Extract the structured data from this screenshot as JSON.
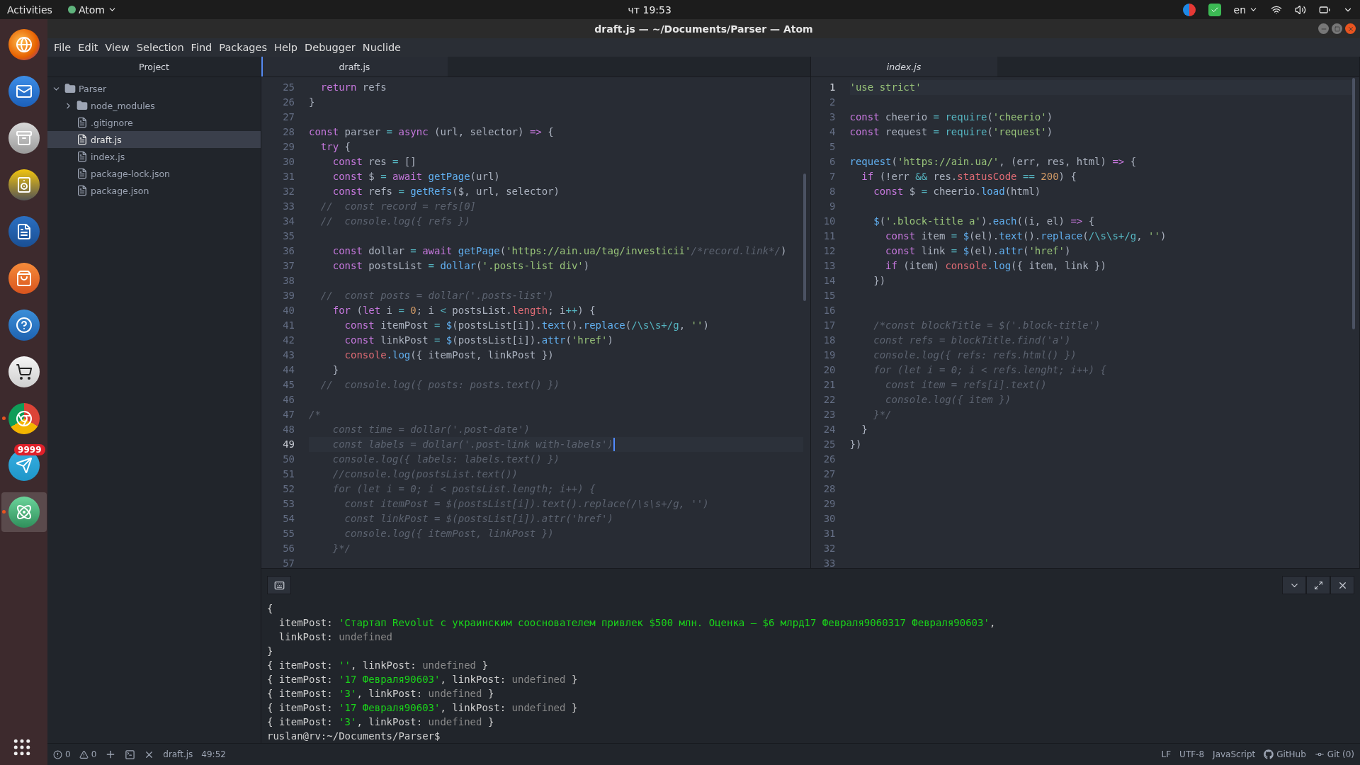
{
  "top_bar": {
    "activities": "Activities",
    "app_menu": "Atom",
    "clock": "чт 19:53",
    "language": "en"
  },
  "dock": [
    {
      "kind": "browser",
      "running": false,
      "selected": false
    },
    {
      "kind": "mail",
      "running": false,
      "selected": false
    },
    {
      "kind": "files",
      "running": false,
      "selected": false
    },
    {
      "kind": "speaker",
      "running": false,
      "selected": false
    },
    {
      "kind": "writer",
      "running": false,
      "selected": false
    },
    {
      "kind": "store",
      "running": false,
      "selected": false
    },
    {
      "kind": "help",
      "running": false,
      "selected": false
    },
    {
      "kind": "cart",
      "running": false,
      "selected": false
    },
    {
      "kind": "chrome",
      "running": true,
      "selected": false
    },
    {
      "kind": "plane",
      "running": false,
      "selected": false,
      "badge": "9999"
    },
    {
      "kind": "atom",
      "running": true,
      "selected": true
    }
  ],
  "window": {
    "title": "draft.js — ~/Documents/Parser — Atom"
  },
  "menu": [
    "File",
    "Edit",
    "View",
    "Selection",
    "Find",
    "Packages",
    "Help",
    "Debugger",
    "Nuclide"
  ],
  "tree": {
    "tab": "Project",
    "root": {
      "name": "Parser",
      "kind": "folder",
      "expanded": true,
      "selected": false,
      "children": [
        {
          "name": "node_modules",
          "kind": "folder",
          "expanded": false,
          "selected": false
        },
        {
          "name": ".gitignore",
          "kind": "file",
          "selected": false
        },
        {
          "name": "draft.js",
          "kind": "file",
          "selected": true
        },
        {
          "name": "index.js",
          "kind": "file",
          "selected": false
        },
        {
          "name": "package-lock.json",
          "kind": "file",
          "selected": false
        },
        {
          "name": "package.json",
          "kind": "file",
          "selected": false
        }
      ]
    }
  },
  "panes": [
    {
      "focused": true,
      "tabs": [
        {
          "label": "draft.js",
          "selected": true,
          "pending": false
        }
      ],
      "lines": [
        {
          "n": "25",
          "current": false,
          "tokens": [
            {
              "kind": "kw",
              "text": "  return"
            },
            {
              "kind": "p",
              "text": " refs"
            }
          ]
        },
        {
          "n": "26",
          "current": false,
          "tokens": [
            {
              "kind": "p",
              "text": "}"
            }
          ]
        },
        {
          "n": "27",
          "current": false
        },
        {
          "n": "28",
          "current": false,
          "tokens": [
            {
              "kind": "kw",
              "text": "const"
            },
            {
              "kind": "p",
              "text": " parser"
            },
            {
              "kind": "op",
              "text": " ="
            },
            {
              "kind": "kw",
              "text": " async"
            },
            {
              "kind": "p",
              "text": " (url, selector)"
            },
            {
              "kind": "kw",
              "text": " =>"
            },
            {
              "kind": "p",
              "text": " {"
            }
          ]
        },
        {
          "n": "29",
          "current": false,
          "tokens": [
            {
              "kind": "kw",
              "text": "  try"
            },
            {
              "kind": "p",
              "text": " {"
            }
          ]
        },
        {
          "n": "30",
          "current": false,
          "tokens": [
            {
              "kind": "kw",
              "text": "    const"
            },
            {
              "kind": "p",
              "text": " res"
            },
            {
              "kind": "op",
              "text": " ="
            },
            {
              "kind": "p",
              "text": " []"
            }
          ]
        },
        {
          "n": "31",
          "current": false,
          "tokens": [
            {
              "kind": "kw",
              "text": "    const"
            },
            {
              "kind": "p",
              "text": " $"
            },
            {
              "kind": "op",
              "text": " ="
            },
            {
              "kind": "kw",
              "text": " await"
            },
            {
              "kind": "fn",
              "text": " getPage"
            },
            {
              "kind": "p",
              "text": "(url)"
            }
          ]
        },
        {
          "n": "32",
          "current": false,
          "tokens": [
            {
              "kind": "kw",
              "text": "    const"
            },
            {
              "kind": "p",
              "text": " refs"
            },
            {
              "kind": "op",
              "text": " ="
            },
            {
              "kind": "fn",
              "text": " getRefs"
            },
            {
              "kind": "p",
              "text": "($, url, selector)"
            }
          ]
        },
        {
          "n": "33",
          "current": false,
          "tokens": [
            {
              "kind": "cm",
              "text": "  //  const record = refs[0]"
            }
          ]
        },
        {
          "n": "34",
          "current": false,
          "tokens": [
            {
              "kind": "cm",
              "text": "  //  console.log({ refs })"
            }
          ]
        },
        {
          "n": "35",
          "current": false
        },
        {
          "n": "36",
          "current": false,
          "tokens": [
            {
              "kind": "kw",
              "text": "    const"
            },
            {
              "kind": "p",
              "text": " dollar"
            },
            {
              "kind": "op",
              "text": " ="
            },
            {
              "kind": "kw",
              "text": " await"
            },
            {
              "kind": "fn",
              "text": " getPage"
            },
            {
              "kind": "p",
              "text": "("
            },
            {
              "kind": "str",
              "text": "'https://ain.ua/tag/investicii'"
            },
            {
              "kind": "cm",
              "text": "/*record.link*/"
            },
            {
              "kind": "p",
              "text": ")"
            }
          ]
        },
        {
          "n": "37",
          "current": false,
          "tokens": [
            {
              "kind": "kw",
              "text": "    const"
            },
            {
              "kind": "p",
              "text": " postsList"
            },
            {
              "kind": "op",
              "text": " ="
            },
            {
              "kind": "fn",
              "text": " dollar"
            },
            {
              "kind": "p",
              "text": "("
            },
            {
              "kind": "str",
              "text": "'.posts-list div'"
            },
            {
              "kind": "p",
              "text": ")"
            }
          ]
        },
        {
          "n": "38",
          "current": false
        },
        {
          "n": "39",
          "current": false,
          "tokens": [
            {
              "kind": "cm",
              "text": "  //  const posts = dollar('.posts-list')"
            }
          ]
        },
        {
          "n": "40",
          "current": false,
          "tokens": [
            {
              "kind": "kw",
              "text": "    for"
            },
            {
              "kind": "p",
              "text": " ("
            },
            {
              "kind": "kw",
              "text": "let"
            },
            {
              "kind": "p",
              "text": " i"
            },
            {
              "kind": "op",
              "text": " ="
            },
            {
              "kind": "num",
              "text": " 0"
            },
            {
              "kind": "p",
              "text": "; i"
            },
            {
              "kind": "op",
              "text": " <"
            },
            {
              "kind": "p",
              "text": " postsList."
            },
            {
              "kind": "prop",
              "text": "length"
            },
            {
              "kind": "p",
              "text": "; i"
            },
            {
              "kind": "op",
              "text": "++"
            },
            {
              "kind": "p",
              "text": ") {"
            }
          ]
        },
        {
          "n": "41",
          "current": false,
          "tokens": [
            {
              "kind": "kw",
              "text": "      const"
            },
            {
              "kind": "p",
              "text": " itemPost"
            },
            {
              "kind": "op",
              "text": " ="
            },
            {
              "kind": "fn",
              "text": " $"
            },
            {
              "kind": "p",
              "text": "(postsList[i])."
            },
            {
              "kind": "fn",
              "text": "text"
            },
            {
              "kind": "p",
              "text": "()."
            },
            {
              "kind": "fn",
              "text": "replace"
            },
            {
              "kind": "p",
              "text": "("
            },
            {
              "kind": "op",
              "text": "/\\s\\s+/g"
            },
            {
              "kind": "p",
              "text": ","
            },
            {
              "kind": "str",
              "text": " ''"
            },
            {
              "kind": "p",
              "text": ")"
            }
          ]
        },
        {
          "n": "42",
          "current": false,
          "tokens": [
            {
              "kind": "kw",
              "text": "      const"
            },
            {
              "kind": "p",
              "text": " linkPost"
            },
            {
              "kind": "op",
              "text": " ="
            },
            {
              "kind": "fn",
              "text": " $"
            },
            {
              "kind": "p",
              "text": "(postsList[i])."
            },
            {
              "kind": "fn",
              "text": "attr"
            },
            {
              "kind": "p",
              "text": "("
            },
            {
              "kind": "str",
              "text": "'href'"
            },
            {
              "kind": "p",
              "text": ")"
            }
          ]
        },
        {
          "n": "43",
          "current": false,
          "tokens": [
            {
              "kind": "prop",
              "text": "      console"
            },
            {
              "kind": "fn",
              "text": ".log"
            },
            {
              "kind": "p",
              "text": "({ itemPost, linkPost })"
            }
          ]
        },
        {
          "n": "44",
          "current": false,
          "tokens": [
            {
              "kind": "p",
              "text": "    }"
            }
          ]
        },
        {
          "n": "45",
          "current": false,
          "tokens": [
            {
              "kind": "cm",
              "text": "  //  console.log({ posts: posts.text() })"
            }
          ]
        },
        {
          "n": "46",
          "current": false
        },
        {
          "n": "47",
          "current": false,
          "tokens": [
            {
              "kind": "cm",
              "text": "/*"
            }
          ]
        },
        {
          "n": "48",
          "current": false,
          "tokens": [
            {
              "kind": "cm",
              "text": "    const time = dollar('.post-date')"
            }
          ]
        },
        {
          "n": "49",
          "current": true,
          "tokens": [
            {
              "kind": "cm",
              "text": "    const labels = dollar('.post-link with-labels')"
            }
          ]
        },
        {
          "n": "50",
          "current": false,
          "tokens": [
            {
              "kind": "cm",
              "text": "    console.log({ labels: labels.text() })"
            }
          ]
        },
        {
          "n": "51",
          "current": false,
          "tokens": [
            {
              "kind": "cm",
              "text": "    //console.log(postsList.text())"
            }
          ]
        },
        {
          "n": "52",
          "current": false,
          "tokens": [
            {
              "kind": "cm",
              "text": "    for (let i = 0; i < postsList.length; i++) {"
            }
          ]
        },
        {
          "n": "53",
          "current": false,
          "tokens": [
            {
              "kind": "cm",
              "text": "      const itemPost = $(postsList[i]).text().replace(/\\s\\s+/g, '')"
            }
          ]
        },
        {
          "n": "54",
          "current": false,
          "tokens": [
            {
              "kind": "cm",
              "text": "      const linkPost = $(postsList[i]).attr('href')"
            }
          ]
        },
        {
          "n": "55",
          "current": false,
          "tokens": [
            {
              "kind": "cm",
              "text": "      console.log({ itemPost, linkPost })"
            }
          ]
        },
        {
          "n": "56",
          "current": false,
          "tokens": [
            {
              "kind": "cm",
              "text": "    }*/"
            }
          ]
        },
        {
          "n": "57",
          "current": false
        }
      ]
    },
    {
      "focused": false,
      "tabs": [
        {
          "label": "index.js",
          "selected": true,
          "pending": true
        }
      ],
      "lines": [
        {
          "n": "1",
          "current": true,
          "tokens": [
            {
              "kind": "str",
              "text": "'use strict'"
            }
          ]
        },
        {
          "n": "2",
          "current": false
        },
        {
          "n": "3",
          "current": false,
          "tokens": [
            {
              "kind": "kw",
              "text": "const"
            },
            {
              "kind": "p",
              "text": " cheerio"
            },
            {
              "kind": "op",
              "text": " ="
            },
            {
              "kind": "op",
              "text": " require"
            },
            {
              "kind": "p",
              "text": "("
            },
            {
              "kind": "str",
              "text": "'cheerio'"
            },
            {
              "kind": "p",
              "text": ")"
            }
          ]
        },
        {
          "n": "4",
          "current": false,
          "tokens": [
            {
              "kind": "kw",
              "text": "const"
            },
            {
              "kind": "p",
              "text": " request"
            },
            {
              "kind": "op",
              "text": " ="
            },
            {
              "kind": "op",
              "text": " require"
            },
            {
              "kind": "p",
              "text": "("
            },
            {
              "kind": "str",
              "text": "'request'"
            },
            {
              "kind": "p",
              "text": ")"
            }
          ]
        },
        {
          "n": "5",
          "current": false
        },
        {
          "n": "6",
          "current": false,
          "tokens": [
            {
              "kind": "fn",
              "text": "request"
            },
            {
              "kind": "p",
              "text": "("
            },
            {
              "kind": "str",
              "text": "'https://ain.ua/'"
            },
            {
              "kind": "p",
              "text": ", (err, res, html)"
            },
            {
              "kind": "kw",
              "text": " =>"
            },
            {
              "kind": "p",
              "text": " {"
            }
          ]
        },
        {
          "n": "7",
          "current": false,
          "tokens": [
            {
              "kind": "kw",
              "text": "  if"
            },
            {
              "kind": "p",
              "text": " (!err"
            },
            {
              "kind": "op",
              "text": " &&"
            },
            {
              "kind": "p",
              "text": " res."
            },
            {
              "kind": "prop",
              "text": "statusCode"
            },
            {
              "kind": "op",
              "text": " =="
            },
            {
              "kind": "num",
              "text": " 200"
            },
            {
              "kind": "p",
              "text": ") {"
            }
          ]
        },
        {
          "n": "8",
          "current": false,
          "tokens": [
            {
              "kind": "kw",
              "text": "    const"
            },
            {
              "kind": "p",
              "text": " $"
            },
            {
              "kind": "op",
              "text": " ="
            },
            {
              "kind": "p",
              "text": " cheerio."
            },
            {
              "kind": "fn",
              "text": "load"
            },
            {
              "kind": "p",
              "text": "(html)"
            }
          ]
        },
        {
          "n": "9",
          "current": false
        },
        {
          "n": "10",
          "current": false,
          "tokens": [
            {
              "kind": "fn",
              "text": "    $"
            },
            {
              "kind": "p",
              "text": "("
            },
            {
              "kind": "str",
              "text": "'.block-title a'"
            },
            {
              "kind": "p",
              "text": ")."
            },
            {
              "kind": "fn",
              "text": "each"
            },
            {
              "kind": "p",
              "text": "((i, el)"
            },
            {
              "kind": "kw",
              "text": " =>"
            },
            {
              "kind": "p",
              "text": " {"
            }
          ]
        },
        {
          "n": "11",
          "current": false,
          "tokens": [
            {
              "kind": "kw",
              "text": "      const"
            },
            {
              "kind": "p",
              "text": " item"
            },
            {
              "kind": "op",
              "text": " ="
            },
            {
              "kind": "fn",
              "text": " $"
            },
            {
              "kind": "p",
              "text": "(el)."
            },
            {
              "kind": "fn",
              "text": "text"
            },
            {
              "kind": "p",
              "text": "()."
            },
            {
              "kind": "fn",
              "text": "replace"
            },
            {
              "kind": "p",
              "text": "("
            },
            {
              "kind": "op",
              "text": "/\\s\\s+/g"
            },
            {
              "kind": "p",
              "text": ","
            },
            {
              "kind": "str",
              "text": " ''"
            },
            {
              "kind": "p",
              "text": ")"
            }
          ]
        },
        {
          "n": "12",
          "current": false,
          "tokens": [
            {
              "kind": "kw",
              "text": "      const"
            },
            {
              "kind": "p",
              "text": " link"
            },
            {
              "kind": "op",
              "text": " ="
            },
            {
              "kind": "fn",
              "text": " $"
            },
            {
              "kind": "p",
              "text": "(el)."
            },
            {
              "kind": "fn",
              "text": "attr"
            },
            {
              "kind": "p",
              "text": "("
            },
            {
              "kind": "str",
              "text": "'href'"
            },
            {
              "kind": "p",
              "text": ")"
            }
          ]
        },
        {
          "n": "13",
          "current": false,
          "tokens": [
            {
              "kind": "kw",
              "text": "      if"
            },
            {
              "kind": "p",
              "text": " (item)"
            },
            {
              "kind": "prop",
              "text": " console"
            },
            {
              "kind": "fn",
              "text": ".log"
            },
            {
              "kind": "p",
              "text": "({ item, link })"
            }
          ]
        },
        {
          "n": "14",
          "current": false,
          "tokens": [
            {
              "kind": "p",
              "text": "    })"
            }
          ]
        },
        {
          "n": "15",
          "current": false
        },
        {
          "n": "16",
          "current": false
        },
        {
          "n": "17",
          "current": false,
          "tokens": [
            {
              "kind": "cm",
              "text": "    /*const blockTitle = $('.block-title')"
            }
          ]
        },
        {
          "n": "18",
          "current": false,
          "tokens": [
            {
              "kind": "cm",
              "text": "    const refs = blockTitle.find('a')"
            }
          ]
        },
        {
          "n": "19",
          "current": false,
          "tokens": [
            {
              "kind": "cm",
              "text": "    console.log({ refs: refs.html() })"
            }
          ]
        },
        {
          "n": "20",
          "current": false,
          "tokens": [
            {
              "kind": "cm",
              "text": "    for (let i = 0; i < refs.lenght; i++) {"
            }
          ]
        },
        {
          "n": "21",
          "current": false,
          "tokens": [
            {
              "kind": "cm",
              "text": "      const item = refs[i].text()"
            }
          ]
        },
        {
          "n": "22",
          "current": false,
          "tokens": [
            {
              "kind": "cm",
              "text": "      console.log({ item })"
            }
          ]
        },
        {
          "n": "23",
          "current": false,
          "tokens": [
            {
              "kind": "cm",
              "text": "    }*/"
            }
          ]
        },
        {
          "n": "24",
          "current": false,
          "tokens": [
            {
              "kind": "p",
              "text": "  }"
            }
          ]
        },
        {
          "n": "25",
          "current": false,
          "tokens": [
            {
              "kind": "p",
              "text": "})"
            }
          ]
        },
        {
          "n": "26",
          "current": false
        },
        {
          "n": "27",
          "current": false
        },
        {
          "n": "28",
          "current": false
        },
        {
          "n": "29",
          "current": false
        },
        {
          "n": "30",
          "current": false
        },
        {
          "n": "31",
          "current": false
        },
        {
          "n": "32",
          "current": false
        },
        {
          "n": "33",
          "current": false
        }
      ]
    }
  ],
  "terminal": {
    "lines": [
      [
        {
          "kind": "p",
          "text": "{"
        }
      ],
      [
        {
          "kind": "p",
          "text": "  itemPost:"
        },
        {
          "kind": "str",
          "text": " 'Стартап Revolut с украинским сооснователем привлек $500 млн. Оценка — $6 млрд17 Февраля9060317 Февраля90603'"
        },
        {
          "kind": "p",
          "text": ","
        }
      ],
      [
        {
          "kind": "p",
          "text": "  linkPost:"
        },
        {
          "kind": "dim",
          "text": " undefined"
        }
      ],
      [
        {
          "kind": "p",
          "text": "}"
        }
      ],
      [
        {
          "kind": "p",
          "text": "{ itemPost:"
        },
        {
          "kind": "str",
          "text": " ''"
        },
        {
          "kind": "p",
          "text": ", linkPost:"
        },
        {
          "kind": "dim",
          "text": " undefined"
        },
        {
          "kind": "p",
          "text": " }"
        }
      ],
      [
        {
          "kind": "p",
          "text": "{ itemPost:"
        },
        {
          "kind": "str",
          "text": " '17 Февраля90603'"
        },
        {
          "kind": "p",
          "text": ", linkPost:"
        },
        {
          "kind": "dim",
          "text": " undefined"
        },
        {
          "kind": "p",
          "text": " }"
        }
      ],
      [
        {
          "kind": "p",
          "text": "{ itemPost:"
        },
        {
          "kind": "str",
          "text": " '3'"
        },
        {
          "kind": "p",
          "text": ", linkPost:"
        },
        {
          "kind": "dim",
          "text": " undefined"
        },
        {
          "kind": "p",
          "text": " }"
        }
      ],
      [
        {
          "kind": "p",
          "text": "{ itemPost:"
        },
        {
          "kind": "str",
          "text": " '17 Февраля90603'"
        },
        {
          "kind": "p",
          "text": ", linkPost:"
        },
        {
          "kind": "dim",
          "text": " undefined"
        },
        {
          "kind": "p",
          "text": " }"
        }
      ],
      [
        {
          "kind": "p",
          "text": "{ itemPost:"
        },
        {
          "kind": "str",
          "text": " '3'"
        },
        {
          "kind": "p",
          "text": ", linkPost:"
        },
        {
          "kind": "dim",
          "text": " undefined"
        },
        {
          "kind": "p",
          "text": " }"
        }
      ],
      [
        {
          "kind": "p",
          "text": "ruslan@rv:~/Documents/Parser$"
        }
      ]
    ]
  },
  "status_bar": {
    "errors": "0",
    "warnings": "0",
    "file": "draft.js",
    "cursor": "49:52",
    "line_ending": "LF",
    "encoding": "UTF-8",
    "grammar": "JavaScript",
    "github": "GitHub",
    "git": "Git (0)"
  }
}
